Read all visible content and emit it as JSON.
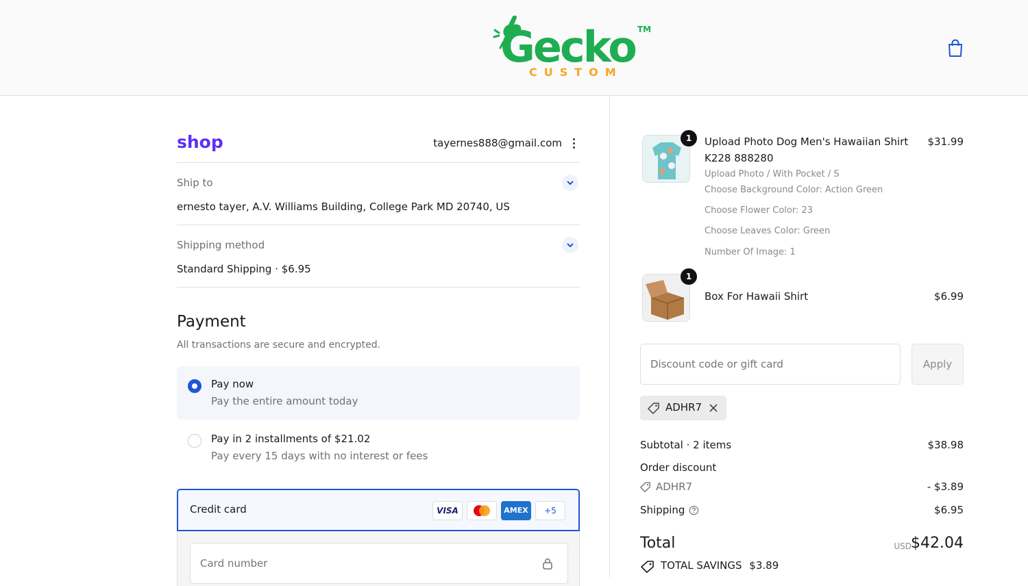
{
  "colors": {
    "accent": "#1f56d6",
    "shop_purple": "#5a31f4",
    "logo_green": "#1fad52",
    "logo_orange": "#f5a623",
    "muted_text": "#707070"
  },
  "header": {
    "logo": {
      "word": "Gecko",
      "sub": "CUSTOM",
      "tm": "TM"
    },
    "cart_icon": "shopping-bag-icon"
  },
  "account": {
    "shop_logo": "shop",
    "email": "tayernes888@gmail.com",
    "menu_icon": "kebab-menu-icon"
  },
  "ship_to": {
    "label": "Ship to",
    "value": "ernesto tayer, A.V. Williams Building, College Park MD 20740, US"
  },
  "shipping_method": {
    "label": "Shipping method",
    "value": "Standard Shipping · $6.95"
  },
  "payment": {
    "title": "Payment",
    "subtitle": "All transactions are secure and encrypted.",
    "options": [
      {
        "title": "Pay now",
        "desc": "Pay the entire amount today",
        "selected": true
      },
      {
        "title": "Pay in 2 installments of $21.02",
        "desc": "Pay every 15 days with no interest or fees",
        "selected": false
      }
    ],
    "credit_card": {
      "label": "Credit card",
      "logos": [
        "VISA",
        "Mastercard",
        "AMEX",
        "+5"
      ],
      "card_number_placeholder": "Card number"
    }
  },
  "order": {
    "items": [
      {
        "qty": "1",
        "name": "Upload Photo Dog Men's Hawaiian Shirt K228 888280",
        "price": "$31.99",
        "variants": [
          "Upload Photo / With Pocket / S",
          "Choose Background Color: Action Green",
          "Choose Flower Color: 23",
          "Choose Leaves Color: Green",
          "Number Of Image: 1"
        ]
      },
      {
        "qty": "1",
        "name": "Box For Hawaii Shirt",
        "price": "$6.99",
        "variants": []
      }
    ],
    "discount": {
      "placeholder": "Discount code or gift card",
      "apply_label": "Apply",
      "applied_code": "ADHR7"
    },
    "summary": {
      "subtotal_label": "Subtotal · 2 items",
      "subtotal_value": "$38.98",
      "order_discount_label": "Order discount",
      "discount_code": "ADHR7",
      "discount_value": "- $3.89",
      "shipping_label": "Shipping",
      "shipping_value": "$6.95",
      "total_label": "Total",
      "currency": "USD",
      "total_value": "$42.04",
      "savings_label": "TOTAL SAVINGS",
      "savings_value": "$3.89"
    }
  }
}
